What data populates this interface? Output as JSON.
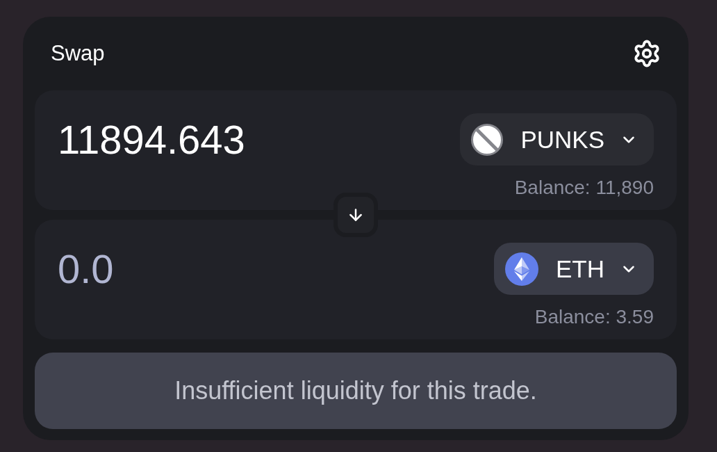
{
  "header": {
    "title": "Swap"
  },
  "panels": [
    {
      "amount": {
        "value": "11894.643"
      },
      "token": {
        "symbol": "PUNKS",
        "hovered": false
      },
      "balance": "Balance: 11,890"
    },
    {
      "amount": {
        "placeholder": "0.0"
      },
      "token": {
        "symbol": "ETH",
        "hovered": true
      },
      "balance": "Balance: 3.59"
    }
  ],
  "action_button": {
    "label": "Insufficient liquidity for this trade.",
    "disabled": true
  }
}
